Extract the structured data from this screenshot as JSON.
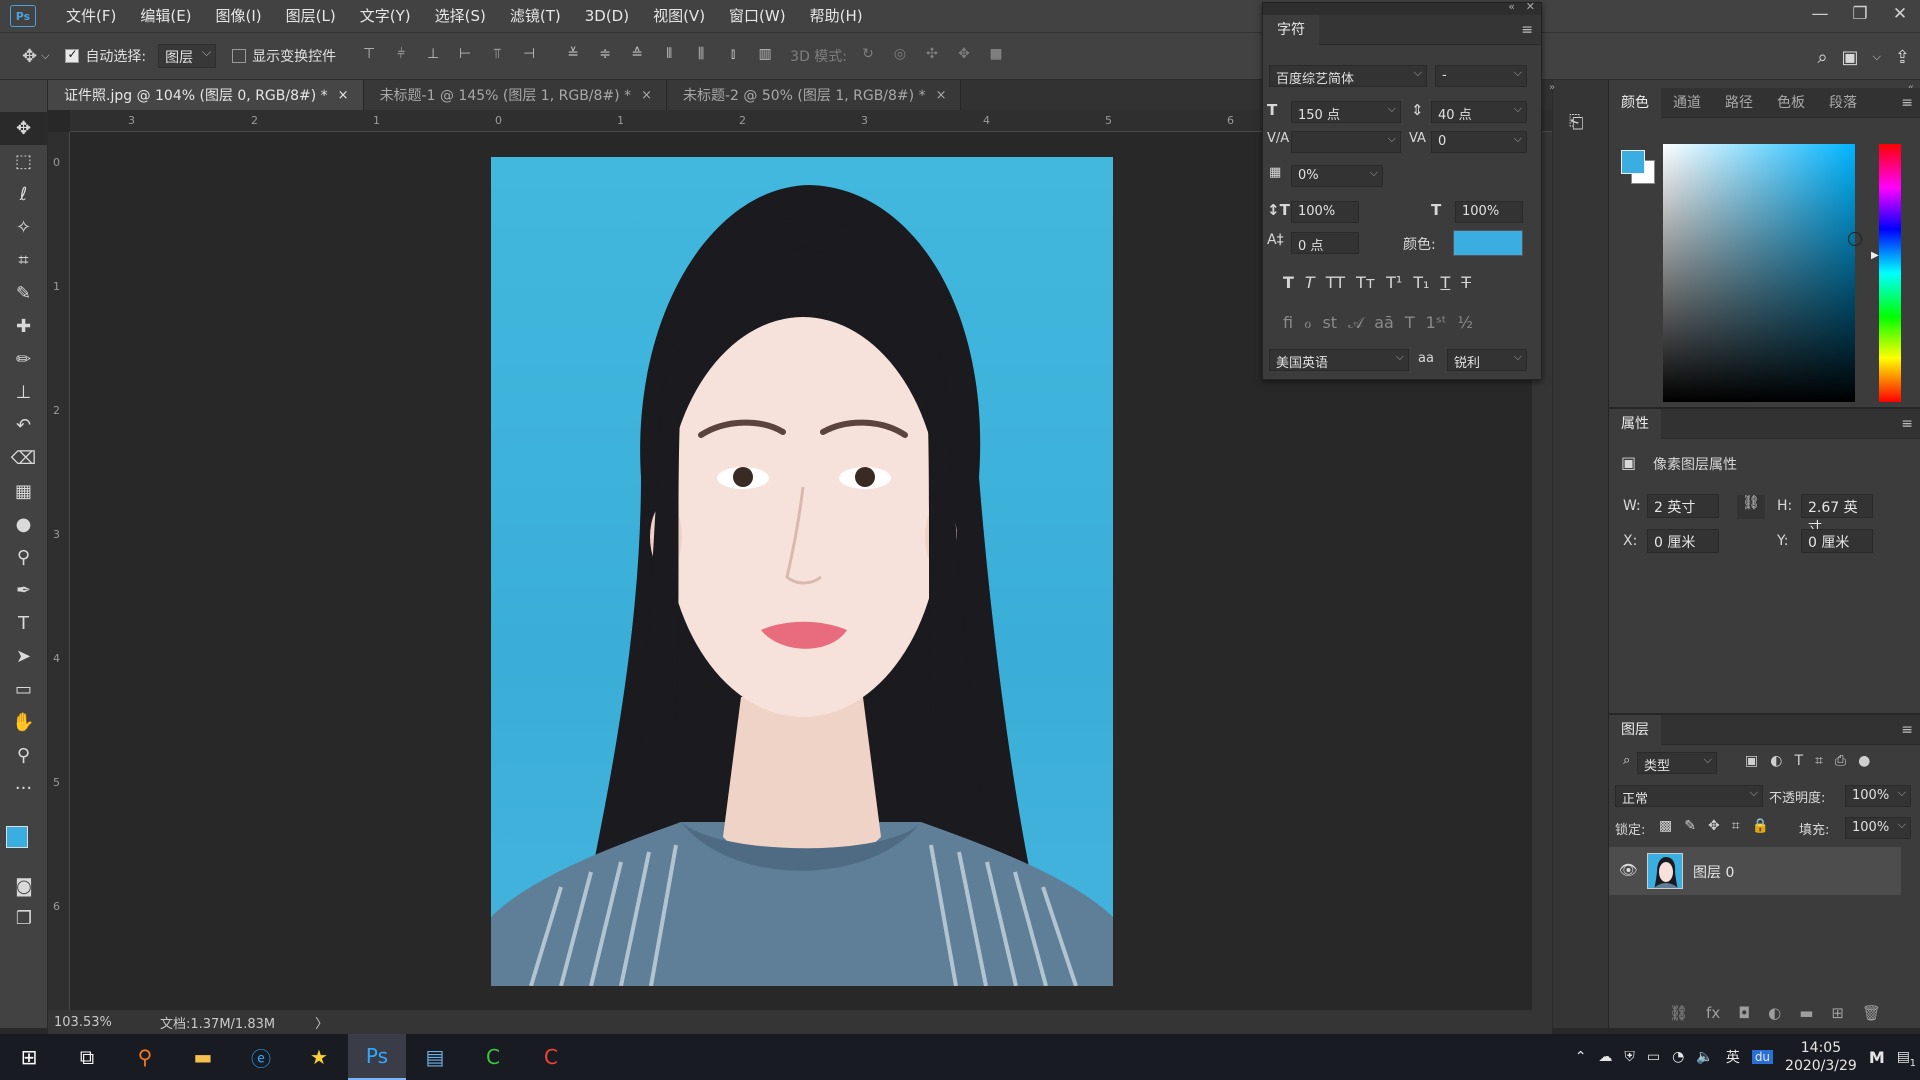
{
  "app": {
    "logo": "Ps"
  },
  "menu": [
    "文件(F)",
    "编辑(E)",
    "图像(I)",
    "图层(L)",
    "文字(Y)",
    "选择(S)",
    "滤镜(T)",
    "3D(D)",
    "视图(V)",
    "窗口(W)",
    "帮助(H)"
  ],
  "window_controls": {
    "minimize": "—",
    "restore": "❐",
    "close": "✕"
  },
  "options": {
    "auto_select_label": "自动选择:",
    "auto_select_value": "图层",
    "show_transform_label": "显示变换控件",
    "mode_3d_label": "3D 模式:"
  },
  "tabs": [
    {
      "label": "证件照.jpg @ 104% (图层 0, RGB/8#) *",
      "close": "×"
    },
    {
      "label": "未标题-1 @ 145% (图层 1, RGB/8#) *",
      "close": "×"
    },
    {
      "label": "未标题-2 @ 50% (图层 1, RGB/8#) *",
      "close": "×"
    }
  ],
  "ruler_h": [
    "3",
    "2",
    "1",
    "0",
    "1",
    "2",
    "3",
    "4",
    "5",
    "6"
  ],
  "ruler_v": [
    "0",
    "1",
    "2",
    "3",
    "4",
    "5",
    "6"
  ],
  "status": {
    "zoom": "103.53%",
    "doc": "文档:1.37M/1.83M",
    "arrow": "〉"
  },
  "character_panel": {
    "tab": "字符",
    "font_family": "百度综艺简体",
    "font_style": "-",
    "font_size": "150 点",
    "leading": "40 点",
    "kerning": "",
    "tracking": "0",
    "tsume": "0%",
    "vertical_scale": "100%",
    "horizontal_scale": "100%",
    "baseline_shift": "0 点",
    "color_label": "颜色:",
    "color": "#3aaee0",
    "language": "美国英语",
    "antialias_label": "aa",
    "antialias": "锐利"
  },
  "color_panel": {
    "tabs": [
      "颜色",
      "通道",
      "路径",
      "色板",
      "段落"
    ],
    "foreground": "#3aaee0",
    "background": "#ffffff"
  },
  "properties": {
    "title": "属性",
    "subtitle": "像素图层属性",
    "w_label": "W:",
    "w_value": "2 英寸",
    "h_label": "H:",
    "h_value": "2.67 英寸",
    "x_label": "X:",
    "x_value": "0 厘米",
    "y_label": "Y:",
    "y_value": "0 厘米"
  },
  "layers": {
    "title": "图层",
    "filter_type": "类型",
    "blend_mode": "正常",
    "opacity_label": "不透明度:",
    "opacity": "100%",
    "lock_label": "锁定:",
    "fill_label": "填充:",
    "fill": "100%",
    "items": [
      {
        "name": "图层 0",
        "visible": true
      }
    ]
  },
  "taskbar": {
    "time": "14:05",
    "date": "2020/3/29",
    "ime": "英",
    "notification_count": "1"
  }
}
